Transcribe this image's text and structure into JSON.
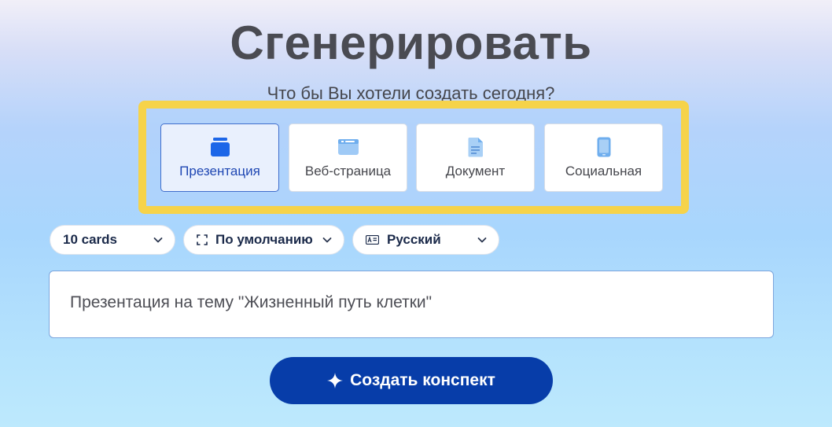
{
  "page": {
    "title": "Сгенерировать",
    "subtitle": "Что бы Вы хотели создать сегодня?"
  },
  "content_types": [
    {
      "label": "Презентация",
      "icon": "stack-cards-icon",
      "selected": true
    },
    {
      "label": "Веб-страница",
      "icon": "browser-window-icon",
      "selected": false
    },
    {
      "label": "Документ",
      "icon": "document-icon",
      "selected": false
    },
    {
      "label": "Социальная",
      "icon": "phone-icon",
      "selected": false
    }
  ],
  "options": {
    "cards": {
      "value": "10 cards"
    },
    "format": {
      "icon": "aspect-ratio-icon",
      "value": "По умолчанию"
    },
    "language": {
      "icon": "language-icon",
      "value": "Русский"
    }
  },
  "prompt": {
    "value": "Презентация на тему \"Жизненный путь клетки\""
  },
  "generate_button": {
    "label": "Создать конспект",
    "icon": "sparkle-icon"
  },
  "colors": {
    "accent": "#073da9",
    "highlight_frame": "#f6d34a",
    "selected_card_border": "#3f6dcc",
    "selected_card_text": "#1f47b3"
  }
}
